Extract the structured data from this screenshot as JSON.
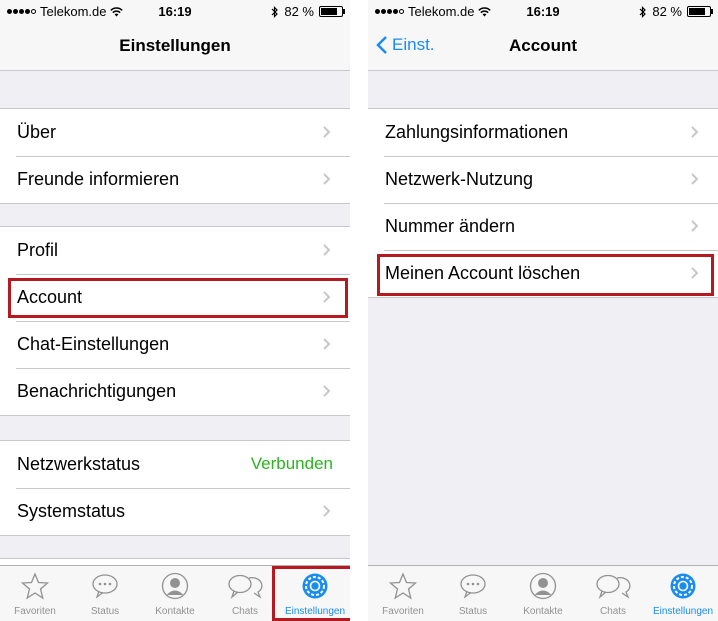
{
  "left": {
    "status": {
      "carrier": "Telekom.de",
      "time": "16:19",
      "battery": "82 %",
      "battery_level": 0.82
    },
    "title": "Einstellungen",
    "groups": [
      [
        {
          "label": "Über"
        },
        {
          "label": "Freunde informieren"
        }
      ],
      [
        {
          "label": "Profil"
        },
        {
          "label": "Account"
        },
        {
          "label": "Chat-Einstellungen"
        },
        {
          "label": "Benachrichtigungen"
        }
      ],
      [
        {
          "label": "Netzwerkstatus",
          "value": "Verbunden"
        },
        {
          "label": "Systemstatus"
        }
      ]
    ]
  },
  "right": {
    "status": {
      "carrier": "Telekom.de",
      "time": "16:19",
      "battery": "82 %",
      "battery_level": 0.82
    },
    "back": "Einst.",
    "title": "Account",
    "groups": [
      [
        {
          "label": "Zahlungsinformationen"
        },
        {
          "label": "Netzwerk-Nutzung"
        },
        {
          "label": "Nummer ändern"
        },
        {
          "label": "Meinen Account löschen"
        }
      ]
    ]
  },
  "tabs": [
    {
      "label": "Favoriten",
      "icon": "star-icon"
    },
    {
      "label": "Status",
      "icon": "speech-bubble-icon"
    },
    {
      "label": "Kontakte",
      "icon": "contact-icon"
    },
    {
      "label": "Chats",
      "icon": "chats-icon"
    },
    {
      "label": "Einstellungen",
      "icon": "gear-icon",
      "active": true
    }
  ],
  "colors": {
    "accent": "#1a8cf0",
    "connected": "#2bb520",
    "highlight": "#b41a1f"
  }
}
